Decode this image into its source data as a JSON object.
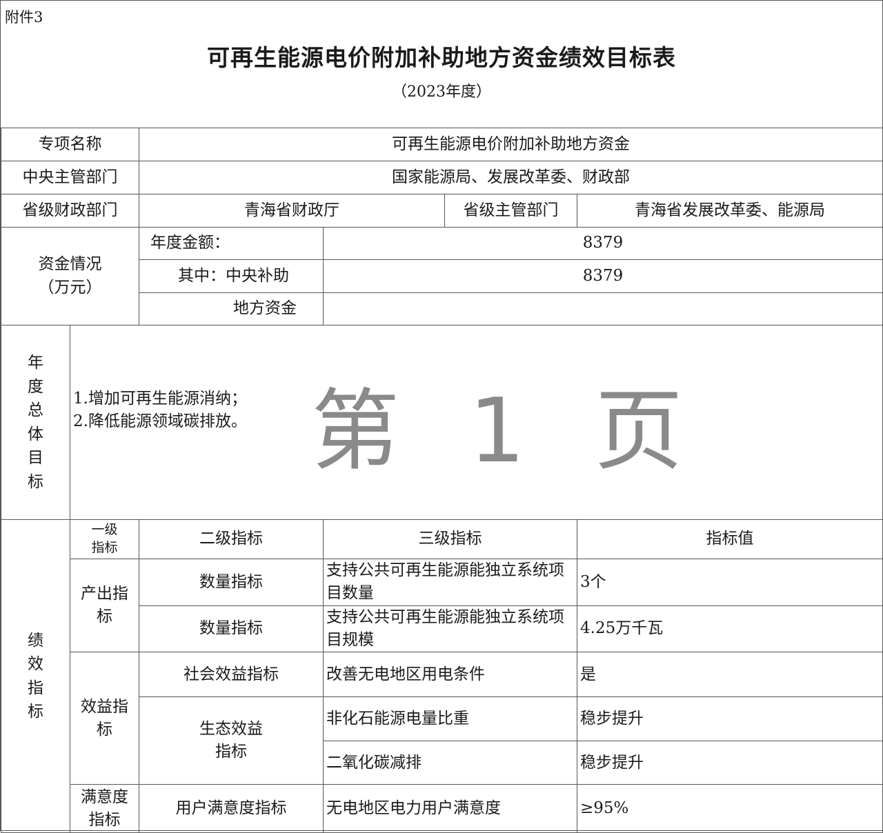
{
  "header": {
    "attachment": "附件3",
    "title": "可再生能源电价附加补助地方资金绩效目标表",
    "year": "（2023年度）"
  },
  "info": {
    "project_label": "专项名称",
    "project_value": "可再生能源电价附加补助地方资金",
    "central_dept_label": "中央主管部门",
    "central_dept_value": "国家能源局、发展改革委、财政部",
    "prov_finance_label": "省级财政部门",
    "prov_finance_value": "青海省财政厅",
    "prov_dept_label": "省级主管部门",
    "prov_dept_value": "青海省发展改革委、能源局"
  },
  "funds": {
    "label_line1": "资金情况",
    "label_line2": "（万元）",
    "annual_label": "年度金额：",
    "annual_value": "8379",
    "central_label": "其中：中央补助",
    "central_value": "8379",
    "local_label": "地方资金",
    "local_value": ""
  },
  "goal": {
    "label": "年度总体目标",
    "line1": "1.增加可再生能源消纳；",
    "line2": "2.降低能源领域碳排放。"
  },
  "watermark": "第 1 页",
  "performance": {
    "label": "绩效指标",
    "headers": {
      "level1": "一级指标",
      "level2": "二级指标",
      "level3": "三级指标",
      "value": "指标值"
    },
    "output_label": "产出指标",
    "benefit_label": "效益指标",
    "satisfaction_label": "满意度指标",
    "rows": [
      {
        "level2": "数量指标",
        "level3": "支持公共可再生能源能独立系统项目数量",
        "value": "3个"
      },
      {
        "level2": "数量指标",
        "level3": "支持公共可再生能源能独立系统项目规模",
        "value": "4.25万千瓦"
      },
      {
        "level2": "社会效益指标",
        "level3": "改善无电地区用电条件",
        "value": "是"
      },
      {
        "level2": "生态效益指标",
        "level3": "非化石能源电量比重",
        "value": "稳步提升"
      },
      {
        "level2": "",
        "level3": "二氧化碳减排",
        "value": "稳步提升"
      },
      {
        "level2": "用户满意度指标",
        "level3": "无电地区电力用户满意度",
        "value": "≥95%"
      }
    ]
  }
}
